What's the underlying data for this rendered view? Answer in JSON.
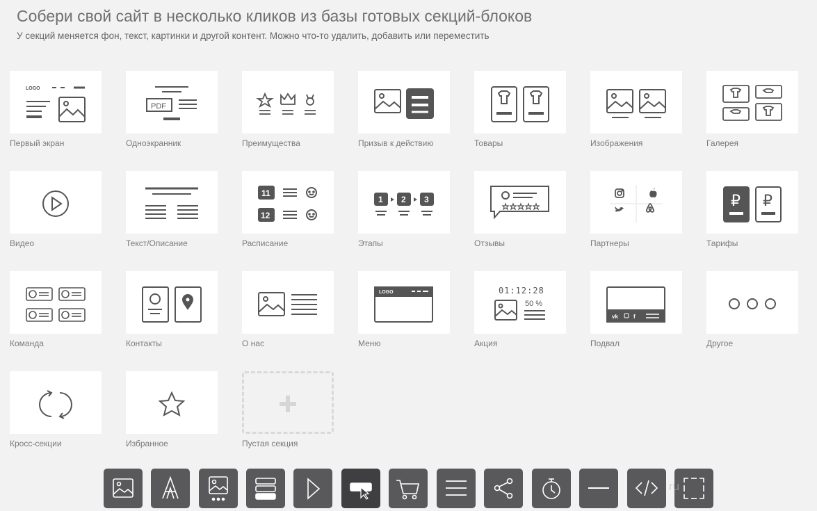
{
  "header": {
    "title": "Собери свой сайт в несколько кликов из базы готовых секций-блоков",
    "subtitle": "У секций меняется фон, текст, картинки и другой контент. Можно что-то удалить, добавить или переместить"
  },
  "sections": [
    {
      "label": "Первый экран",
      "icon": "first-screen-icon"
    },
    {
      "label": "Одноэкранник",
      "icon": "one-screen-pdf-icon"
    },
    {
      "label": "Преимущества",
      "icon": "advantages-icon"
    },
    {
      "label": "Призыв к действию",
      "icon": "call-to-action-icon"
    },
    {
      "label": "Товары",
      "icon": "products-icon"
    },
    {
      "label": "Изображения",
      "icon": "images-icon"
    },
    {
      "label": "Галерея",
      "icon": "gallery-icon"
    },
    {
      "label": "Видео",
      "icon": "video-icon"
    },
    {
      "label": "Текст/Описание",
      "icon": "text-description-icon"
    },
    {
      "label": "Расписание",
      "icon": "schedule-icon"
    },
    {
      "label": "Этапы",
      "icon": "stages-icon"
    },
    {
      "label": "Отзывы",
      "icon": "reviews-icon"
    },
    {
      "label": "Партнеры",
      "icon": "partners-icon"
    },
    {
      "label": "Тарифы",
      "icon": "tariffs-icon"
    },
    {
      "label": "Команда",
      "icon": "team-icon"
    },
    {
      "label": "Контакты",
      "icon": "contacts-icon"
    },
    {
      "label": "О нас",
      "icon": "about-icon"
    },
    {
      "label": "Меню",
      "icon": "menu-icon"
    },
    {
      "label": "Акция",
      "icon": "promo-icon"
    },
    {
      "label": "Подвал",
      "icon": "footer-icon"
    },
    {
      "label": "Другое",
      "icon": "other-icon"
    },
    {
      "label": "Кросс-секции",
      "icon": "cross-sections-icon"
    },
    {
      "label": "Избранное",
      "icon": "favorites-icon"
    },
    {
      "label": "Пустая секция",
      "icon": "plus-icon"
    }
  ],
  "icon_text": {
    "logo": "LOGO",
    "pdf": "PDF",
    "schedule_nums": [
      "11",
      "12"
    ],
    "stage_nums": [
      "1",
      "2",
      "3"
    ],
    "timer": "01:12:28",
    "discount": "50 %",
    "ruble": "₽",
    "footer_social": [
      "vk",
      "f"
    ]
  },
  "toolbar": [
    {
      "name": "image-tool-icon"
    },
    {
      "name": "text-tool-icon"
    },
    {
      "name": "slider-tool-icon"
    },
    {
      "name": "form-tool-icon"
    },
    {
      "name": "video-tool-icon"
    },
    {
      "name": "button-tool-icon"
    },
    {
      "name": "cart-tool-icon"
    },
    {
      "name": "menu-tool-icon"
    },
    {
      "name": "share-tool-icon"
    },
    {
      "name": "timer-tool-icon"
    },
    {
      "name": "divider-tool-icon"
    },
    {
      "name": "code-tool-icon"
    },
    {
      "name": "frame-tool-icon"
    }
  ],
  "watermark": "ru",
  "colors": {
    "background": "#f2f2f2",
    "icon": "#555555",
    "label": "#7a7a7a",
    "toolbar": "#59595c"
  }
}
